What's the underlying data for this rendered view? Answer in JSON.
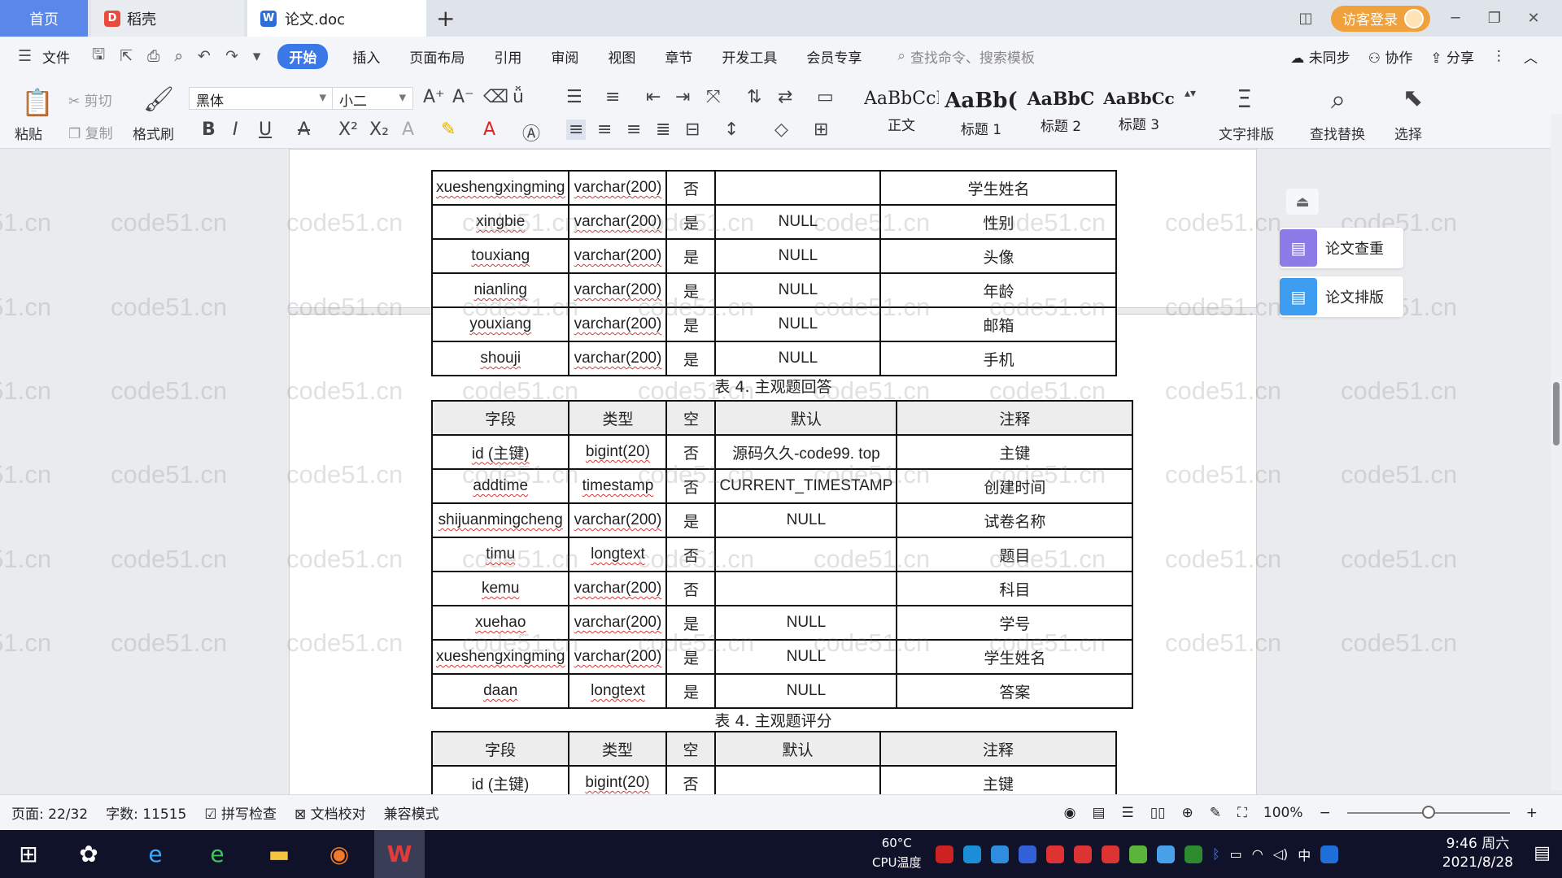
{
  "tabs": {
    "home": "首页",
    "daoke": "稻壳",
    "document": "论文.doc",
    "new_tab": "+"
  },
  "title_bar": {
    "login": "访客登录"
  },
  "menu": {
    "file": "文件",
    "items": [
      "开始",
      "插入",
      "页面布局",
      "引用",
      "审阅",
      "视图",
      "章节",
      "开发工具",
      "会员专享"
    ],
    "search": "查找命令、搜索模板",
    "unsynced": "未同步",
    "collab": "协作",
    "share": "分享"
  },
  "ribbon": {
    "paste": "粘贴",
    "cut": "剪切",
    "copy": "复制",
    "format_painter": "格式刷",
    "font_name": "黑体",
    "font_size": "小二",
    "styles": [
      {
        "sample": "AaBbCcI",
        "label": "正文"
      },
      {
        "sample": "AaBb(",
        "label": "标题 1"
      },
      {
        "sample": "AaBbC",
        "label": "标题 2"
      },
      {
        "sample": "AaBbCc",
        "label": "标题 3"
      }
    ],
    "text_layout": "文字排版",
    "find_replace": "查找替换",
    "select": "选择"
  },
  "side_panel": {
    "check": "论文查重",
    "layout": "论文排版"
  },
  "table1": {
    "rows": [
      [
        "xueshengxingming",
        "varchar(200)",
        "否",
        "",
        "学生姓名"
      ],
      [
        "xingbie",
        "varchar(200)",
        "是",
        "NULL",
        "性别"
      ],
      [
        "touxiang",
        "varchar(200)",
        "是",
        "NULL",
        "头像"
      ],
      [
        "nianling",
        "varchar(200)",
        "是",
        "NULL",
        "年龄"
      ],
      [
        "youxiang",
        "varchar(200)",
        "是",
        "NULL",
        "邮箱"
      ],
      [
        "shouji",
        "varchar(200)",
        "是",
        "NULL",
        "手机"
      ]
    ]
  },
  "table2": {
    "caption": "表 4. 主观题回答",
    "headers": [
      "字段",
      "类型",
      "空",
      "默认",
      "注释"
    ],
    "rows": [
      [
        "id (主键)",
        "bigint(20)",
        "否",
        "源码久久-code99. top",
        "主键"
      ],
      [
        "addtime",
        "timestamp",
        "否",
        "CURRENT_TIMESTAMP",
        "创建时间"
      ],
      [
        "shijuanmingcheng",
        "varchar(200)",
        "是",
        "NULL",
        "试卷名称"
      ],
      [
        "timu",
        "longtext",
        "否",
        "",
        "题目"
      ],
      [
        "kemu",
        "varchar(200)",
        "否",
        "",
        "科目"
      ],
      [
        "xuehao",
        "varchar(200)",
        "是",
        "NULL",
        "学号"
      ],
      [
        "xueshengxingming",
        "varchar(200)",
        "是",
        "NULL",
        "学生姓名"
      ],
      [
        "daan",
        "longtext",
        "是",
        "NULL",
        "答案"
      ]
    ]
  },
  "table3": {
    "caption": "表 4. 主观题评分",
    "headers": [
      "字段",
      "类型",
      "空",
      "默认",
      "注释"
    ],
    "rows": [
      [
        "id (主键)",
        "bigint(20)",
        "否",
        "",
        "主键"
      ]
    ]
  },
  "watermark": "code51.cn",
  "status": {
    "page": "页面: 22/32",
    "words": "字数: 11515",
    "spell": "拼写检查",
    "proof": "文档校对",
    "compat": "兼容模式",
    "zoom": "100%"
  },
  "taskbar": {
    "cpu_temp": "60°C",
    "cpu_label": "CPU温度",
    "ime": "中",
    "time": "9:46 周六",
    "date": "2021/8/28"
  },
  "colors": {
    "accent": "#3b78e7",
    "home_tab": "#5b87ea",
    "login": "#f1a13b",
    "taskbar": "#10122a"
  }
}
